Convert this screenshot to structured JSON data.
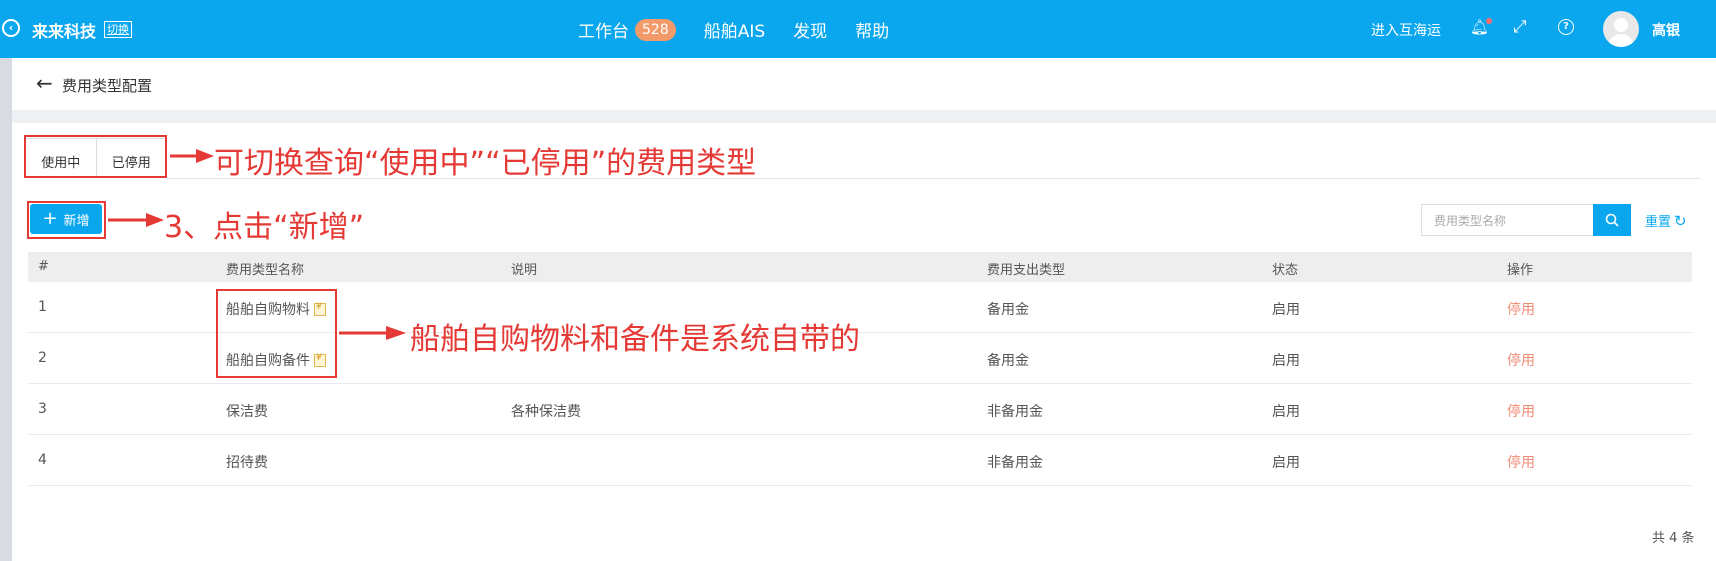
{
  "topbar": {
    "company": "来来科技",
    "switch_label": "切换",
    "nav": [
      {
        "label": "工作台",
        "badge": "528"
      },
      {
        "label": "船舶AIS"
      },
      {
        "label": "发现"
      },
      {
        "label": "帮助"
      }
    ],
    "enter_label": "进入互海运",
    "user_name": "高银",
    "icons": [
      "back-circle-icon",
      "bell-icon",
      "fullscreen-icon",
      "help-icon"
    ]
  },
  "page": {
    "title": "费用类型配置"
  },
  "tabs": {
    "active": "使用中",
    "inactive": "已停用"
  },
  "toolbar": {
    "add_label": "新增",
    "search_placeholder": "费用类型名称",
    "reset_label": "重置"
  },
  "table": {
    "headers": [
      "#",
      "费用类型名称",
      "说明",
      "费用支出类型",
      "状态",
      "操作"
    ],
    "rows": [
      {
        "no": "1",
        "name": "船舶自购物料",
        "desc": "",
        "type": "备用金",
        "status": "启用",
        "op": "停用"
      },
      {
        "no": "2",
        "name": "船舶自购备件",
        "desc": "",
        "type": "备用金",
        "status": "启用",
        "op": "停用"
      },
      {
        "no": "3",
        "name": "保洁费",
        "desc": "各种保洁费",
        "type": "非备用金",
        "status": "启用",
        "op": "停用"
      },
      {
        "no": "4",
        "name": "招待费",
        "desc": "",
        "type": "非备用金",
        "status": "启用",
        "op": "停用"
      }
    ]
  },
  "pagination": {
    "total": "共 4 条"
  },
  "annotations": {
    "tabs_note": "可切换查询“使用中”“已停用”的费用类型",
    "add_note": "3、点击“新增”",
    "system_note": "船舶自购物料和备件是系统自带的"
  },
  "colors": {
    "primary": "#0aa7ef",
    "annotation": "#e53935",
    "action_link": "#f08b76",
    "badge": "#f39a6a"
  }
}
